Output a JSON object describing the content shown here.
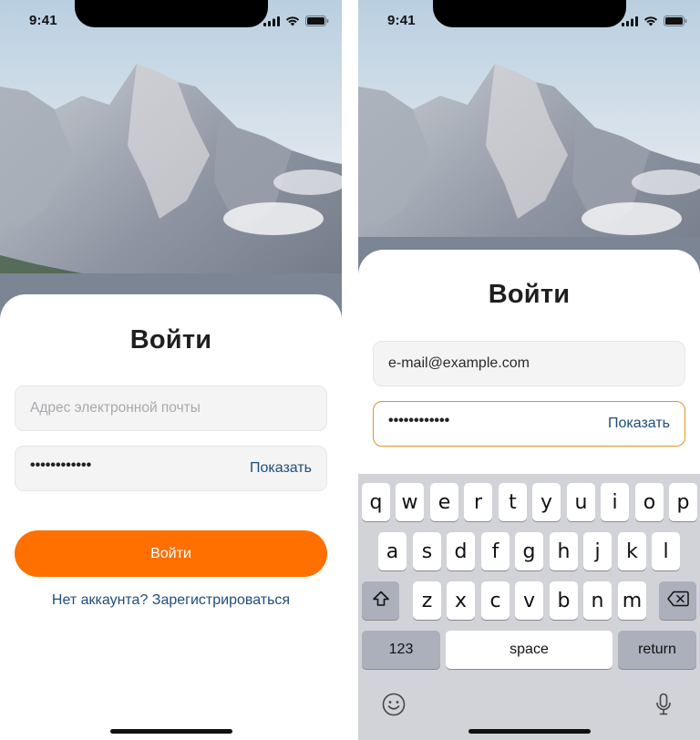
{
  "status_bar": {
    "time": "9:41"
  },
  "login": {
    "title": "Войти",
    "email_placeholder": "Адрес электронной почты",
    "password_dots": "••••••••••••",
    "show_label": "Показать",
    "submit_label": "Войти",
    "register_label": "Нет аккаунта? Зарегистрироваться"
  },
  "login_focused": {
    "title": "Войти",
    "email_value": "e-mail@example.com",
    "password_dots": "••••••••••••",
    "show_label": "Показать"
  },
  "keyboard": {
    "row1": [
      "q",
      "w",
      "e",
      "r",
      "t",
      "y",
      "u",
      "i",
      "o",
      "p"
    ],
    "row2": [
      "a",
      "s",
      "d",
      "f",
      "g",
      "h",
      "j",
      "k",
      "l"
    ],
    "row3": [
      "z",
      "x",
      "c",
      "v",
      "b",
      "n",
      "m"
    ],
    "numbers_label": "123",
    "space_label": "space",
    "return_label": "return"
  },
  "icons": {
    "shift": "shift-icon",
    "backspace": "backspace-icon",
    "emoji": "emoji-icon",
    "mic": "microphone-icon",
    "signal": "signal-icon",
    "wifi": "wifi-icon",
    "battery": "battery-icon"
  },
  "colors": {
    "accent": "#ff7000",
    "link": "#1f4d7a",
    "focus_border": "#e8901f",
    "keyboard_bg": "#d1d3d9"
  }
}
